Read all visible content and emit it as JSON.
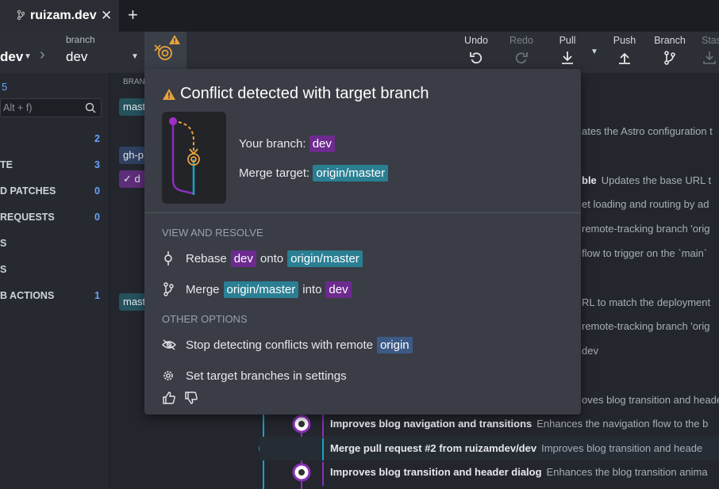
{
  "tab": {
    "title": "ruizam.dev",
    "close": "✕",
    "add": "+"
  },
  "toolbar": {
    "repo": "dev",
    "branch_caption": "branch",
    "branch": "dev",
    "actions": [
      {
        "label": "Undo",
        "icon": "undo-icon",
        "enabled": true
      },
      {
        "label": "Redo",
        "icon": "redo-icon",
        "enabled": false
      },
      {
        "label": "Pull",
        "icon": "pull-icon",
        "enabled": true
      },
      {
        "label": "Push",
        "icon": "push-icon",
        "enabled": true
      },
      {
        "label": "Branch",
        "icon": "branch-icon",
        "enabled": true
      },
      {
        "label": "Stas",
        "icon": "stash-icon",
        "enabled": false
      }
    ]
  },
  "left_panel": {
    "top_count": "5",
    "filter_placeholder": "Alt + f)",
    "rows": [
      {
        "label": "",
        "count": "2"
      },
      {
        "label": "TE",
        "count": "3"
      },
      {
        "label": "D PATCHES",
        "count": "0"
      },
      {
        "label": "REQUESTS",
        "count": "0"
      },
      {
        "label": "S",
        "count": ""
      },
      {
        "label": "S",
        "count": ""
      },
      {
        "label": "B ACTIONS",
        "count": "1"
      }
    ]
  },
  "graph": {
    "branch_header": "BRANC",
    "pills": [
      {
        "text": "mast",
        "type": "teal"
      },
      {
        "text": "gh-p",
        "type": "blue"
      },
      {
        "text": "✓ d",
        "type": "purple"
      },
      {
        "text": "mast",
        "type": "teal"
      }
    ],
    "visible_messages": [
      {
        "title": "",
        "desc": "ates the Astro configuration t"
      },
      {
        "title": "ble",
        "desc": "Updates the base URL t"
      },
      {
        "title": "",
        "desc": "et loading and routing by ad"
      },
      {
        "title": "",
        "desc": "remote-tracking branch 'orig"
      },
      {
        "title": "",
        "desc": "flow to trigger on the `main`"
      },
      {
        "title": "",
        "desc": "RL to match the deployment"
      },
      {
        "title": "",
        "desc": "remote-tracking branch 'orig"
      },
      {
        "title": "",
        "desc": "dev"
      },
      {
        "title": "",
        "desc": "oves blog transition and heade"
      },
      {
        "title": "Improves blog navigation and transitions",
        "desc": "Enhances the navigation flow to the b"
      },
      {
        "title": "Merge pull request #2 from ruizamdev/dev",
        "desc": "Improves blog transition and heade"
      },
      {
        "title": "Improves blog transition and header dialog",
        "desc": "Enhances the blog transition anima"
      }
    ]
  },
  "popup": {
    "title": "Conflict detected with target branch",
    "your_branch_label": "Your branch:",
    "your_branch": "dev",
    "merge_target_label": "Merge target:",
    "merge_target": "origin/master",
    "section_view": "VIEW AND RESOLVE",
    "rebase": {
      "w1": "Rebase",
      "a": "dev",
      "w2": "onto",
      "b": "origin/master"
    },
    "merge": {
      "w1": "Merge",
      "a": "origin/master",
      "w2": "into",
      "b": "dev"
    },
    "section_other": "OTHER OPTIONS",
    "stop_detect": {
      "text": "Stop detecting conflicts with remote",
      "remote": "origin"
    },
    "settings": "Set target branches in settings"
  },
  "colors": {
    "warning": "#e8a33d",
    "purple": "#6d2a8f",
    "teal": "#2a7f93",
    "blue": "#3d5a86",
    "accent_blue": "#6aa3ff"
  }
}
